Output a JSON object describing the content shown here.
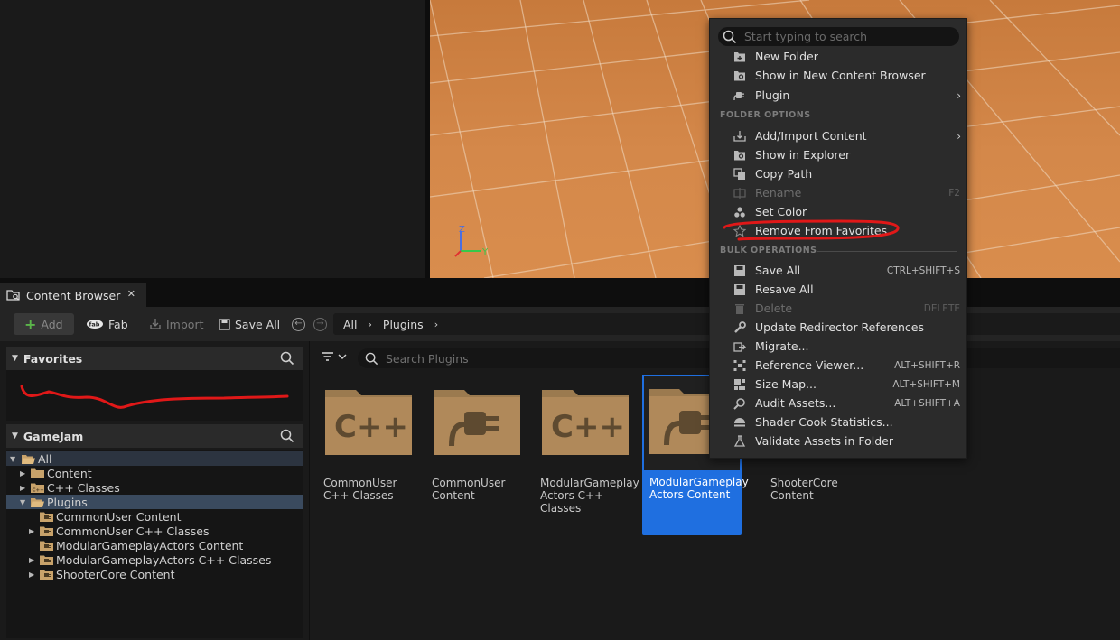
{
  "tab": {
    "title": "Content Browser",
    "close": "✕"
  },
  "toolbar": {
    "add": "Add",
    "fab": "Fab",
    "import": "Import",
    "save_all": "Save All",
    "back": "←",
    "forward": "→",
    "breadcrumb": [
      "All",
      "Plugins"
    ],
    "breadcrumb_sep": "›"
  },
  "favorites": {
    "title": "Favorites"
  },
  "project": {
    "title": "GameJam",
    "tree": [
      {
        "label": "All",
        "depth": 0,
        "expanded": true
      },
      {
        "label": "Content",
        "depth": 1
      },
      {
        "label": "C++ Classes",
        "depth": 1
      },
      {
        "label": "Plugins",
        "depth": 1,
        "expanded": true,
        "selected": true
      },
      {
        "label": "CommonUser Content",
        "depth": 2
      },
      {
        "label": "CommonUser C++ Classes",
        "depth": 2
      },
      {
        "label": "ModularGameplayActors Content",
        "depth": 2
      },
      {
        "label": "ModularGameplayActors C++ Classes",
        "depth": 2
      },
      {
        "label": "ShooterCore Content",
        "depth": 2
      }
    ]
  },
  "main": {
    "search_placeholder": "Search Plugins",
    "tiles": [
      {
        "name": "CommonUser C++ Classes",
        "icon": "cpp-folder-icon"
      },
      {
        "name": "CommonUser Content",
        "icon": "plugin-folder-icon"
      },
      {
        "name": "ModularGameplay Actors C++ Classes",
        "icon": "cpp-folder-icon"
      },
      {
        "name": "ModularGameplay Actors Content",
        "icon": "plugin-folder-icon",
        "selected": true
      },
      {
        "name": "ShooterCore Content",
        "icon": "plugin-folder-icon"
      }
    ]
  },
  "context_menu": {
    "search_placeholder": "Start typing to search",
    "items_top": [
      {
        "label": "New Folder",
        "icon": "new-folder-icon"
      },
      {
        "label": "Show in New Content Browser",
        "icon": "content-browser-icon"
      },
      {
        "label": "Plugin",
        "icon": "plugin-icon",
        "submenu": true
      }
    ],
    "folder_options_title": "FOLDER OPTIONS",
    "folder_options": [
      {
        "label": "Add/Import Content",
        "icon": "import-icon",
        "submenu": true
      },
      {
        "label": "Show in Explorer",
        "icon": "explorer-icon"
      },
      {
        "label": "Copy Path",
        "icon": "copy-icon"
      },
      {
        "label": "Rename",
        "icon": "rename-icon",
        "shortcut": "F2",
        "disabled": true
      },
      {
        "label": "Set Color",
        "icon": "palette-icon"
      },
      {
        "label": "Remove From Favorites",
        "icon": "star-icon"
      }
    ],
    "bulk_title": "BULK OPERATIONS",
    "bulk": [
      {
        "label": "Save All",
        "icon": "save-icon",
        "shortcut": "CTRL+SHIFT+S"
      },
      {
        "label": "Resave All",
        "icon": "save-icon"
      },
      {
        "label": "Delete",
        "icon": "trash-icon",
        "shortcut": "DELETE",
        "disabled": true
      },
      {
        "label": "Update Redirector References",
        "icon": "wrench-icon"
      },
      {
        "label": "Migrate...",
        "icon": "migrate-icon"
      },
      {
        "label": "Reference Viewer...",
        "icon": "reference-viewer-icon",
        "shortcut": "ALT+SHIFT+R"
      },
      {
        "label": "Size Map...",
        "icon": "size-map-icon",
        "shortcut": "ALT+SHIFT+M"
      },
      {
        "label": "Audit Assets...",
        "icon": "audit-icon",
        "shortcut": "ALT+SHIFT+A"
      },
      {
        "label": "Shader Cook Statistics...",
        "icon": "shader-icon"
      },
      {
        "label": "Validate Assets in Folder",
        "icon": "flask-icon"
      }
    ]
  },
  "viewport": {
    "axis_z": "Z",
    "axis_y": "Y"
  },
  "colors": {
    "selection_blue": "#1f6fe0",
    "folder_tan": "#b0895a",
    "annotation_red": "#e01818",
    "floor_orange": "#d4884a"
  }
}
